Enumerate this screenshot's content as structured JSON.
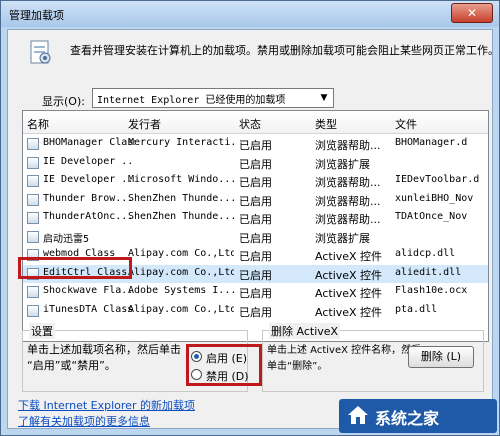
{
  "window": {
    "title": "管理加载项",
    "close_glyph": "✕"
  },
  "header": {
    "description": "查看并管理安装在计算机上的加载项。禁用或删除加载项可能会阻止某些网页正常工作。"
  },
  "show": {
    "label": "显示(O):",
    "selected": "Internet Explorer 已经使用的加载项"
  },
  "table": {
    "columns": [
      "名称",
      "发行者",
      "状态",
      "类型",
      "文件"
    ],
    "rows": [
      [
        "BHOManager Class",
        "Mercury Interacti...",
        "已启用",
        "浏览器帮助...",
        "BHOManager.d"
      ],
      [
        "IE Developer ...",
        "",
        "已启用",
        "浏览器扩展",
        ""
      ],
      [
        "IE Developer ...",
        "Microsoft Windo...",
        "已启用",
        "浏览器帮助...",
        "IEDevToolbar.dl"
      ],
      [
        "Thunder Brow...",
        "ShenZhen Thunde...",
        "已启用",
        "浏览器帮助...",
        "xunleiBHO_Nov"
      ],
      [
        "ThunderAtOnc...",
        "ShenZhen Thunde...",
        "已启用",
        "浏览器帮助...",
        "TDAtOnce_Nov"
      ],
      [
        "启动迅雷5",
        "",
        "已启用",
        "浏览器扩展",
        ""
      ],
      [
        "webmod Class",
        "Alipay.com Co.,Ltd",
        "已启用",
        "ActiveX 控件",
        "alidcp.dll"
      ],
      [
        "EditCtrl Class",
        "Alipay.com Co.,Ltd",
        "已启用",
        "ActiveX 控件",
        "aliedit.dll"
      ],
      [
        "Shockwave Fla...",
        "Adobe Systems I...",
        "已启用",
        "ActiveX 控件",
        "Flash10e.ocx"
      ],
      [
        "iTunesDTA Class",
        "Alipay.com Co.,Ltd",
        "已启用",
        "ActiveX 控件",
        "pta.dll"
      ]
    ]
  },
  "settings": {
    "title": "设置",
    "hint_line1": "单击上述加载项名称，然后单击",
    "hint_line2": "“启用”或“禁用”。",
    "enable_label": "启用 (E)",
    "disable_label": "禁用 (D)",
    "selected": "启用"
  },
  "delete": {
    "title": "删除 ActiveX",
    "hint_line1": "单击上述 ActiveX 控件名称，然后",
    "hint_line2": "单击“删除”。",
    "button_label": "删除 (L)"
  },
  "links": {
    "download": "下载 Internet Explorer 的新加载项",
    "learn_more": "了解有关加载项的更多信息"
  },
  "watermark": {
    "text": "系统之家"
  },
  "colors": {
    "highlight_red": "#c0191c",
    "link_blue": "#0b4dc2",
    "selection": "#d4e8fc"
  }
}
